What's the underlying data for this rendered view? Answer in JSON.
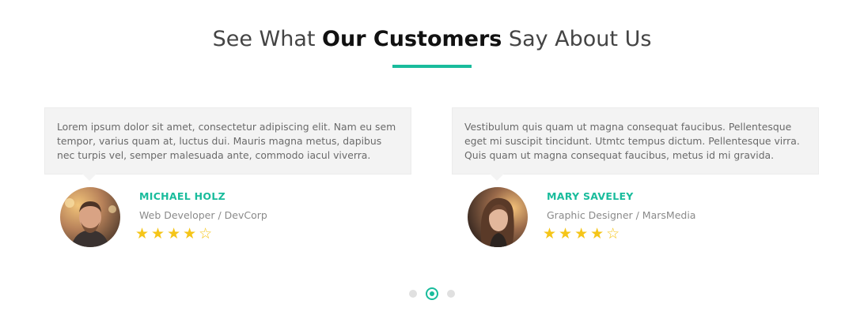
{
  "section": {
    "title_pre": "See What ",
    "title_bold": "Our Customers",
    "title_post": " Say About Us",
    "accent_color": "#19bc9c"
  },
  "testimonials": [
    {
      "quote": "Lorem ipsum dolor sit amet, consectetur adipiscing elit. Nam eu sem tempor, varius quam at, luctus dui. Mauris magna metus, dapibus nec turpis vel, semper malesuada ante, commodo iacul viverra.",
      "name": "MICHAEL HOLZ",
      "role": "Web Developer / DevCorp",
      "rating": 4,
      "max_rating": 5,
      "stars": "★★★★☆",
      "avatar_icon": "man-portrait-photo"
    },
    {
      "quote": "Vestibulum quis quam ut magna consequat faucibus. Pellentesque eget mi suscipit tincidunt. Utmtc tempus dictum. Pellentesque virra. Quis quam ut magna consequat faucibus, metus id mi gravida.",
      "name": "MARY SAVELEY",
      "role": "Graphic Designer / MarsMedia",
      "rating": 4,
      "max_rating": 5,
      "stars": "★★★★☆",
      "avatar_icon": "woman-portrait-photo"
    }
  ],
  "carousel": {
    "pages": 3,
    "active_index": 1
  }
}
